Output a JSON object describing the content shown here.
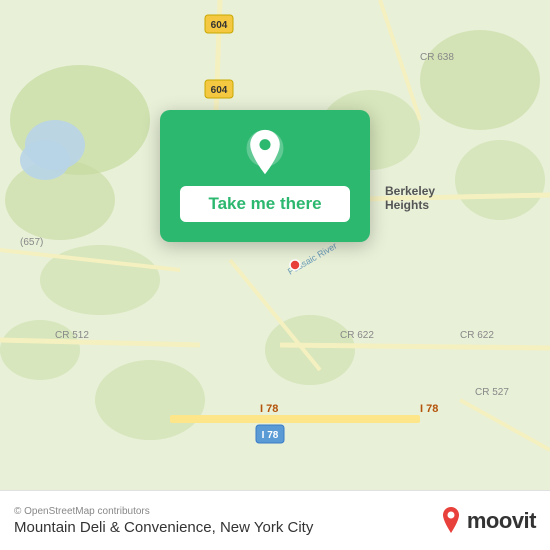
{
  "map": {
    "background_color": "#e8f0d8",
    "attribution": "© OpenStreetMap contributors"
  },
  "card": {
    "button_label": "Take me there",
    "pin_icon": "location-pin"
  },
  "bottom_bar": {
    "copyright": "© OpenStreetMap contributors",
    "location_name": "Mountain Deli & Convenience, New York City",
    "brand": "moovit"
  }
}
